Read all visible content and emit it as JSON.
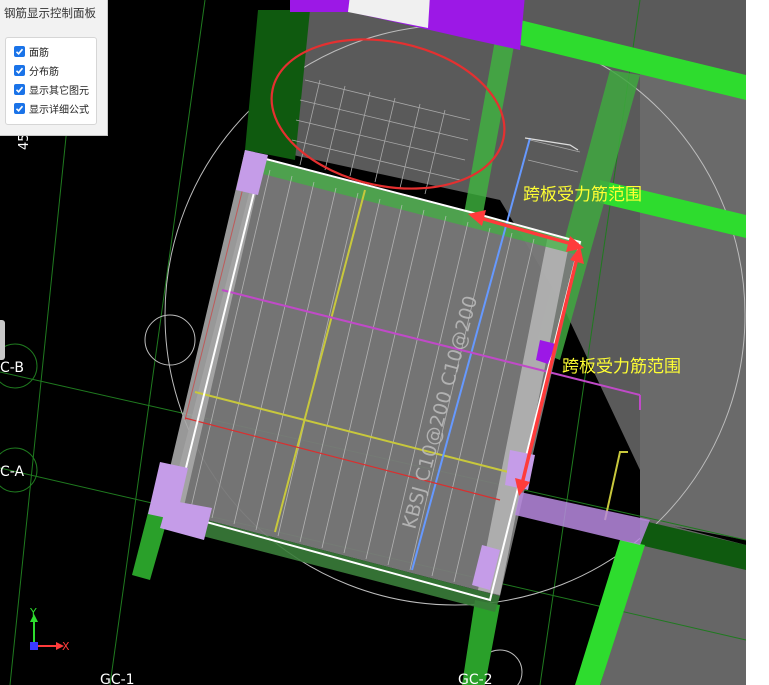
{
  "panel": {
    "title": "钢筋显示控制面板",
    "options": [
      {
        "label": "面筋",
        "checked": true
      },
      {
        "label": "分布筋",
        "checked": true
      },
      {
        "label": "显示其它图元",
        "checked": true
      },
      {
        "label": "显示详细公式",
        "checked": true
      }
    ]
  },
  "annotations": {
    "span_range_top": "跨板受力筋范围",
    "span_range_right": "跨板受力筋范围",
    "rebar_label": "KBSJ C10@200 C10@200"
  },
  "grid_labels": {
    "c_b": "C-B",
    "c_a": "C-A",
    "gc1": "GC-1",
    "gc2": "GC-2",
    "dim": "45"
  },
  "axis": {
    "x": "X",
    "y": "Y"
  },
  "colors": {
    "panel_bg": "#f2f2f2",
    "checkbox": "#1a73e8",
    "beam_green": "#2edc2e",
    "column_purple": "#b98ae0",
    "slab_gray": "#6e6e6e",
    "annotation_yellow": "#ffff33",
    "arrow_red": "#ff3b3b",
    "highlight_circle": "#e53030"
  }
}
